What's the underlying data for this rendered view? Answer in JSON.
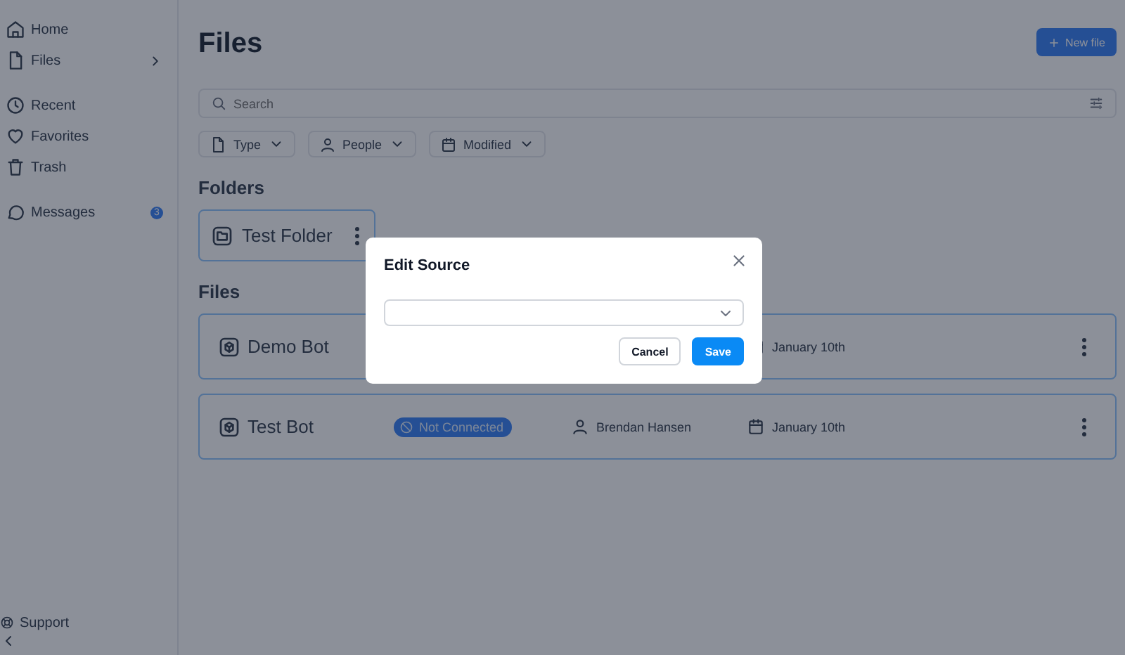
{
  "sidebar": {
    "sections": [
      [
        {
          "label": "Home",
          "has_submenu": false
        },
        {
          "label": "Files",
          "has_submenu": true
        }
      ],
      [
        {
          "label": "Recent",
          "has_submenu": false
        },
        {
          "label": "Favorites",
          "has_submenu": false
        },
        {
          "label": "Trash",
          "has_submenu": false
        }
      ],
      [
        {
          "label": "Messages",
          "has_submenu": false,
          "badge": "3"
        }
      ]
    ],
    "footer": {
      "label": "Support"
    }
  },
  "header": {
    "title": "Files",
    "new_button": "New file"
  },
  "search": {
    "placeholder": "Search"
  },
  "filters": [
    "Type",
    "People",
    "Modified"
  ],
  "folders": {
    "heading": "Folders",
    "items": [
      {
        "name": "Test Folder"
      }
    ]
  },
  "files": {
    "heading": "Files",
    "rows": [
      {
        "name": "Demo Bot",
        "date": "January 10th"
      },
      {
        "name": "Test Bot",
        "status": "Not Connected",
        "owner": "Brendan Hansen",
        "date": "January 10th"
      }
    ]
  },
  "dialog": {
    "title": "Edit Source",
    "buttons": [
      {
        "label": "Cancel",
        "kind": "secondary"
      },
      {
        "label": "Save",
        "kind": "primary"
      }
    ]
  }
}
